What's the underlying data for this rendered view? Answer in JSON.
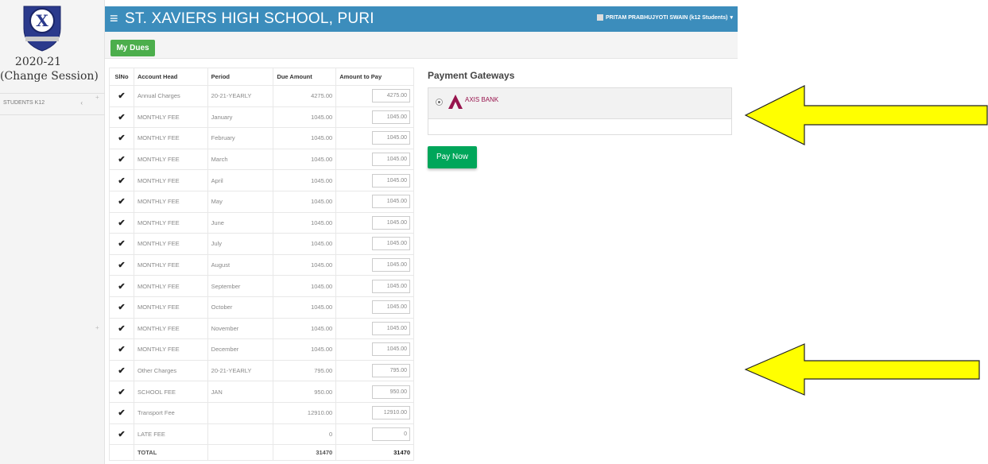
{
  "sidebar": {
    "session_year": "2020-21",
    "session_change": "(Change Session)",
    "menu_item": "STUDENTS K12"
  },
  "header": {
    "menu_icon": "hamburger-icon",
    "school_name": "ST. XAVIERS HIGH SCHOOL, PURI",
    "user_label": "PRITAM PRABHUJYOTI SWAIN (k12 Students)"
  },
  "buttons": {
    "my_dues": "My Dues",
    "pay_now": "Pay Now"
  },
  "table": {
    "headers": {
      "slno": "SlNo",
      "account_head": "Account Head",
      "period": "Period",
      "due_amount": "Due Amount",
      "amount_to_pay": "Amount to Pay"
    },
    "rows": [
      {
        "head": "Annual Charges",
        "period": "20-21-YEARLY",
        "due": "4275.00",
        "pay": "4275.00"
      },
      {
        "head": "MONTHLY FEE",
        "period": "January",
        "due": "1045.00",
        "pay": "1045.00"
      },
      {
        "head": "MONTHLY FEE",
        "period": "February",
        "due": "1045.00",
        "pay": "1045.00"
      },
      {
        "head": "MONTHLY FEE",
        "period": "March",
        "due": "1045.00",
        "pay": "1045.00"
      },
      {
        "head": "MONTHLY FEE",
        "period": "April",
        "due": "1045.00",
        "pay": "1045.00"
      },
      {
        "head": "MONTHLY FEE",
        "period": "May",
        "due": "1045.00",
        "pay": "1045.00"
      },
      {
        "head": "MONTHLY FEE",
        "period": "June",
        "due": "1045.00",
        "pay": "1045.00"
      },
      {
        "head": "MONTHLY FEE",
        "period": "July",
        "due": "1045.00",
        "pay": "1045.00"
      },
      {
        "head": "MONTHLY FEE",
        "period": "August",
        "due": "1045.00",
        "pay": "1045.00"
      },
      {
        "head": "MONTHLY FEE",
        "period": "September",
        "due": "1045.00",
        "pay": "1045.00"
      },
      {
        "head": "MONTHLY FEE",
        "period": "October",
        "due": "1045.00",
        "pay": "1045.00"
      },
      {
        "head": "MONTHLY FEE",
        "period": "November",
        "due": "1045.00",
        "pay": "1045.00"
      },
      {
        "head": "MONTHLY FEE",
        "period": "December",
        "due": "1045.00",
        "pay": "1045.00"
      },
      {
        "head": "Other Charges",
        "period": "20-21-YEARLY",
        "due": "795.00",
        "pay": "795.00"
      },
      {
        "head": "SCHOOL FEE",
        "period": "JAN",
        "due": "950.00",
        "pay": "950.00"
      },
      {
        "head": "Transport Fee",
        "period": "",
        "due": "12910.00",
        "pay": "12910.00"
      },
      {
        "head": "LATE FEE",
        "period": "",
        "due": "0",
        "pay": "0"
      }
    ],
    "total_label": "TOTAL",
    "total_due": "31470",
    "total_pay": "31470"
  },
  "payment": {
    "title": "Payment Gateways",
    "gateway_name": "AXIS BANK",
    "gateway_color": "#97144d"
  },
  "colors": {
    "header_bg": "#3c8dbc",
    "my_dues_bg": "#4cae4c",
    "pay_now_bg": "#00a65a",
    "arrow_fill": "#ffff00"
  }
}
